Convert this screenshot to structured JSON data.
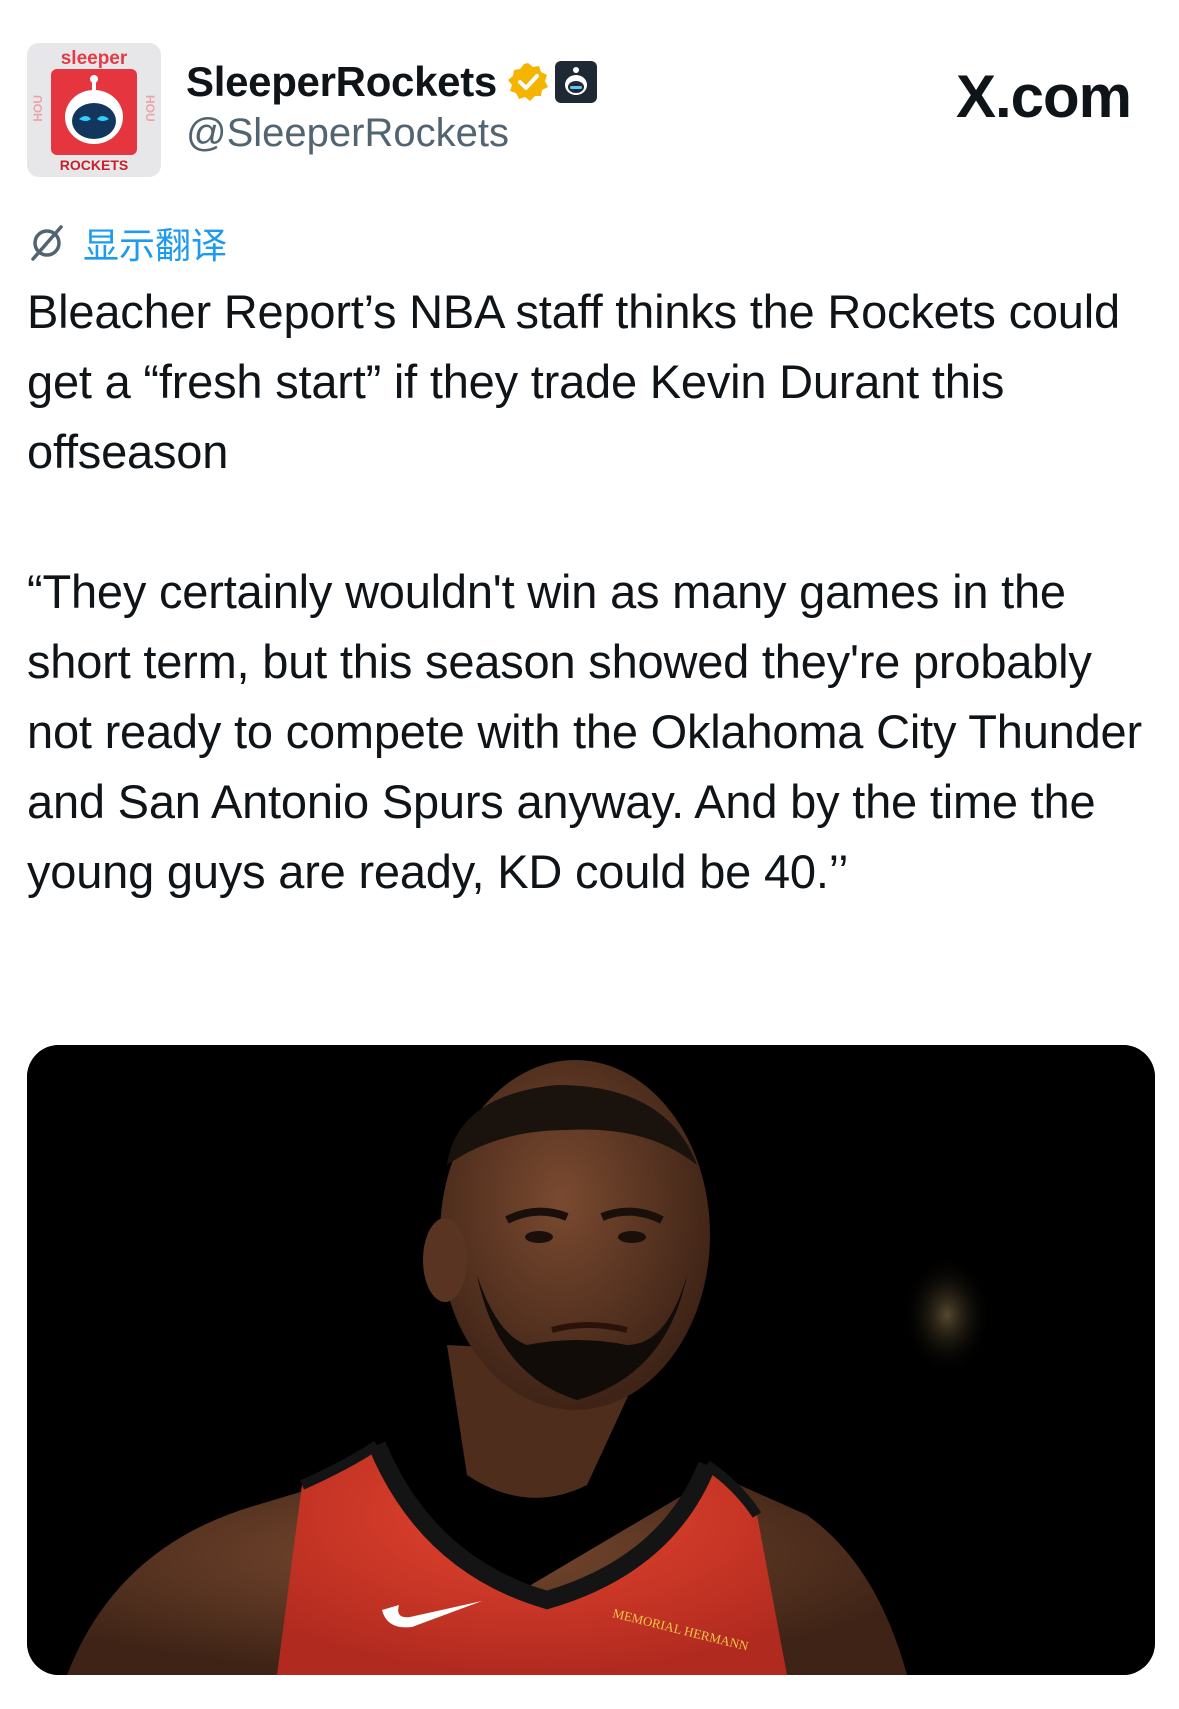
{
  "header": {
    "avatar": {
      "brand_text": "sleeper",
      "team_text": "ROCKETS",
      "side_text": "HOU",
      "icon": "robot-logo-icon"
    },
    "display_name": "SleeperRockets",
    "handle": "@SleeperRockets",
    "verified_icon": "verified-badge-icon",
    "affiliate_icon": "affiliate-badge-icon",
    "site": "X.com"
  },
  "translate": {
    "icon": "translate-icon",
    "label": "显示翻译"
  },
  "post": {
    "paragraph1": "Bleacher Report’s NBA staff thinks the Rockets could get a “fresh start” if they trade Kevin Durant this offseason",
    "paragraph2": "“They certainly wouldn't win as many games in the short term, but this season showed they're probably not ready to compete with the Oklahoma City Thunder and San Antonio Spurs anyway. And by the time the young guys are ready, KD could be 40.’’"
  },
  "media": {
    "jersey_text": "MEMORIAL HERMANN",
    "colors": {
      "jersey": "#d9392c",
      "background": "#000000"
    }
  },
  "colors": {
    "link": "#1d9bf0",
    "text": "#0f1419",
    "muted": "#536471",
    "verified": "#f4b400"
  }
}
